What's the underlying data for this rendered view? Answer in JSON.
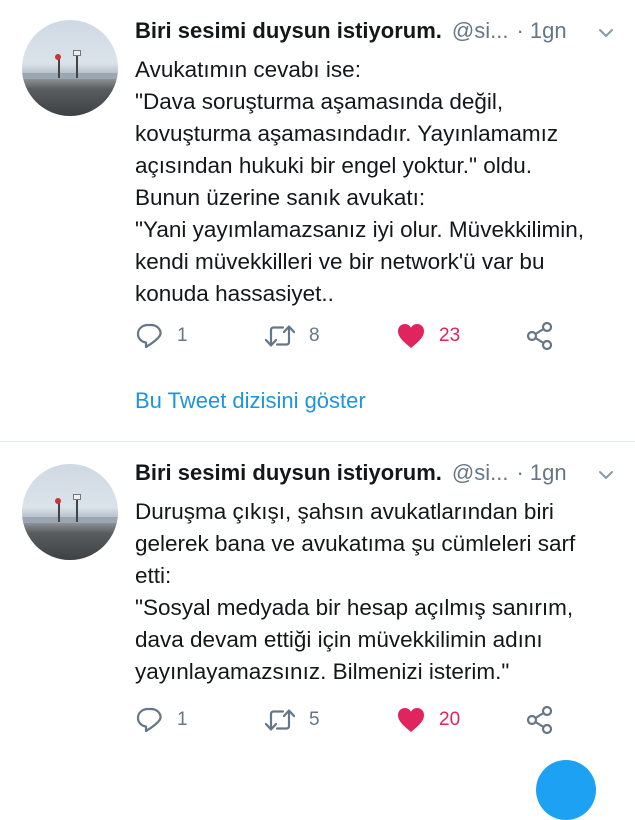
{
  "tweets": [
    {
      "author_name": "Biri sesimi duysun istiyorum.",
      "handle": "@si...",
      "time": "· 1gn",
      "lines": [
        "Avukatımın cevabı ise:",
        "\"Dava soruşturma aşamasında değil,",
        "kovuşturma aşamasındadır. Yayınlamamız",
        "açısından hukuki bir engel yoktur.\" oldu.",
        "Bunun üzerine sanık avukatı:",
        "\"Yani yayımlamazsanız iyi olur. Müvekkilimin,",
        "kendi müvekkilleri ve bir network'ü var bu",
        "konuda hassasiyet.."
      ],
      "replies": "1",
      "retweets": "8",
      "likes": "23",
      "liked": true,
      "thread_link": "Bu Tweet dizisini göster"
    },
    {
      "author_name": "Biri sesimi duysun istiyorum.",
      "handle": "@si...",
      "time": "· 1gn",
      "lines": [
        "Duruşma çıkışı, şahsın avukatlarından biri",
        "gelerek bana ve avukatıma şu cümleleri sarf",
        "etti:",
        "\"Sosyal medyada bir hesap açılmış sanırım,",
        "dava devam ettiği için müvekkilimin adını",
        "yayınlayamazsınız. Bilmenizi isterim.\""
      ],
      "replies": "1",
      "retweets": "5",
      "likes": "20",
      "liked": true
    }
  ],
  "icons": {
    "reply": "reply-icon",
    "retweet": "retweet-icon",
    "like": "heart-icon",
    "share": "share-icon",
    "menu": "chevron-down-icon"
  },
  "colors": {
    "accent": "#1b95e0",
    "like": "#e0245e",
    "muted": "#657786",
    "text": "#14171a"
  }
}
